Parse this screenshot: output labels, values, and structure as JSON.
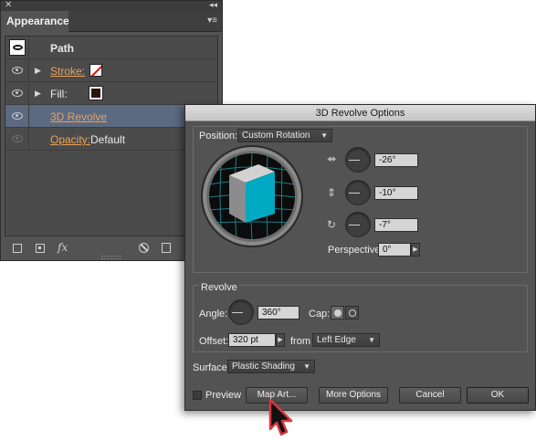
{
  "appearance_panel": {
    "tab_label": "Appearance",
    "close_glyph": "✕",
    "collapse_glyph": "◂◂",
    "menu_glyph": "▾≡",
    "rows": [
      {
        "label": "Path"
      },
      {
        "label": "Stroke:",
        "swatch": "stroke-none-icon"
      },
      {
        "label": "Fill:",
        "swatch": "fill-swatch"
      },
      {
        "label": "3D Revolve"
      },
      {
        "label": "Opacity:",
        "value": "Default"
      }
    ],
    "bottom_icons": [
      "new-stroke-icon",
      "new-fill-icon",
      "add-effect-icon",
      "clear-appearance-icon",
      "duplicate-item-icon"
    ],
    "fx_label": "fx"
  },
  "revolve_dialog": {
    "title": "3D Revolve Options",
    "position": {
      "label": "Position:",
      "value": "Custom Rotation",
      "x_rotation": "-26°",
      "y_rotation": "-10°",
      "z_rotation": "-7°",
      "perspective_label": "Perspective:",
      "perspective_value": "0°"
    },
    "revolve": {
      "group_label": "Revolve",
      "angle_label": "Angle:",
      "angle_value": "360°",
      "cap_label": "Cap:",
      "offset_label": "Offset:",
      "offset_value": "320 pt",
      "from_label": "from",
      "from_value": "Left Edge"
    },
    "surface": {
      "label": "Surface:",
      "value": "Plastic Shading"
    },
    "buttons": {
      "preview_label": "Preview",
      "map_art_label": "Map Art...",
      "more_options_label": "More Options",
      "cancel_label": "Cancel",
      "ok_label": "OK"
    }
  },
  "colors": {
    "panel_bg": "#535353",
    "selected_row": "#5b6981",
    "link_orange": "#e8a25a",
    "cube_front": "#00a9c2",
    "cube_top": "#cfcfcf",
    "cursor_outline": "#d9363e"
  }
}
